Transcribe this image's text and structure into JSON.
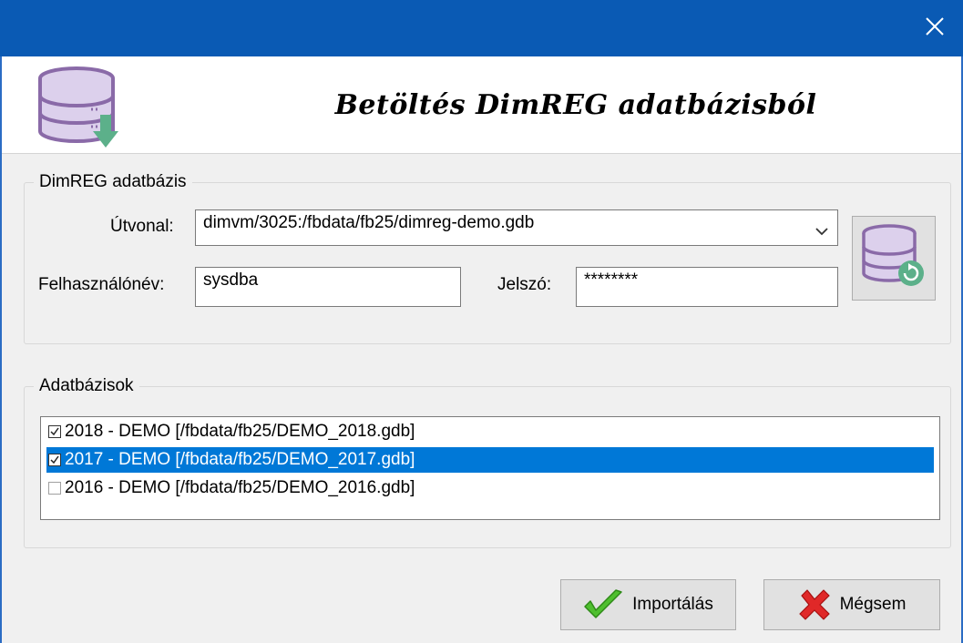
{
  "window": {
    "close_glyph": "✕"
  },
  "header": {
    "title": "Betöltés DimREG adatbázisból",
    "icon": "database-download-icon"
  },
  "db_group": {
    "legend": "DimREG adatbázis",
    "path_label": "Útvonal:",
    "path_value": "dimvm/3025:/fbdata/fb25/dimreg-demo.gdb",
    "user_label": "Felhasználónév:",
    "user_value": "sysdba",
    "password_label": "Jelszó:",
    "password_value": "********",
    "connect_icon": "database-refresh-icon"
  },
  "databases_group": {
    "legend": "Adatbázisok",
    "items": [
      {
        "label": "2018 - DEMO [/fbdata/fb25/DEMO_2018.gdb]",
        "checked": true,
        "selected": false
      },
      {
        "label": "2017 - DEMO [/fbdata/fb25/DEMO_2017.gdb]",
        "checked": true,
        "selected": true
      },
      {
        "label": "2016 - DEMO [/fbdata/fb25/DEMO_2016.gdb]",
        "checked": false,
        "selected": false
      }
    ]
  },
  "buttons": {
    "import_label": "Importálás",
    "cancel_label": "Mégsem"
  },
  "colors": {
    "titlebar": "#0a5ab4",
    "selection": "#0078d7",
    "db_icon_fill": "#dcd0ec",
    "db_icon_stroke": "#8a6aa8",
    "accent_green": "#5cb08a"
  }
}
